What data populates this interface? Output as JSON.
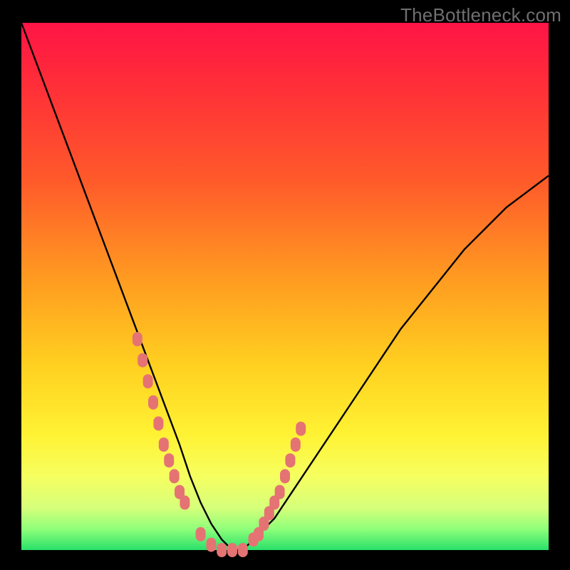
{
  "watermark": "TheBottleneck.com",
  "chart_data": {
    "type": "line",
    "title": "",
    "xlabel": "",
    "ylabel": "",
    "xlim": [
      0,
      100
    ],
    "ylim": [
      0,
      100
    ],
    "series": [
      {
        "name": "bottleneck-curve",
        "x": [
          0,
          3,
          6,
          9,
          12,
          15,
          18,
          21,
          24,
          27,
          30,
          32,
          34,
          36,
          38,
          40,
          42,
          44,
          48,
          52,
          56,
          60,
          64,
          68,
          72,
          76,
          80,
          84,
          88,
          92,
          96,
          100
        ],
        "y": [
          100,
          92,
          84,
          76,
          68,
          60,
          52,
          44,
          36,
          28,
          20,
          14,
          9,
          5,
          2,
          0,
          0,
          2,
          6,
          12,
          18,
          24,
          30,
          36,
          42,
          47,
          52,
          57,
          61,
          65,
          68,
          71
        ]
      }
    ],
    "markers": {
      "name": "highlight-dots",
      "color": "#e57373",
      "points_x": [
        22,
        23,
        24,
        25,
        26,
        27,
        28,
        29,
        30,
        31,
        34,
        36,
        38,
        40,
        42,
        44,
        45,
        46,
        47,
        48,
        49,
        50,
        51,
        52,
        53
      ],
      "points_y": [
        40,
        36,
        32,
        28,
        24,
        20,
        17,
        14,
        11,
        9,
        3,
        1,
        0,
        0,
        0,
        2,
        3,
        5,
        7,
        9,
        11,
        14,
        17,
        20,
        23
      ]
    },
    "gradient_stops": [
      {
        "pos": 0.0,
        "color": "#ff1446"
      },
      {
        "pos": 0.3,
        "color": "#ff5a2a"
      },
      {
        "pos": 0.65,
        "color": "#ffd020"
      },
      {
        "pos": 0.86,
        "color": "#f6ff60"
      },
      {
        "pos": 1.0,
        "color": "#29e06a"
      }
    ]
  }
}
